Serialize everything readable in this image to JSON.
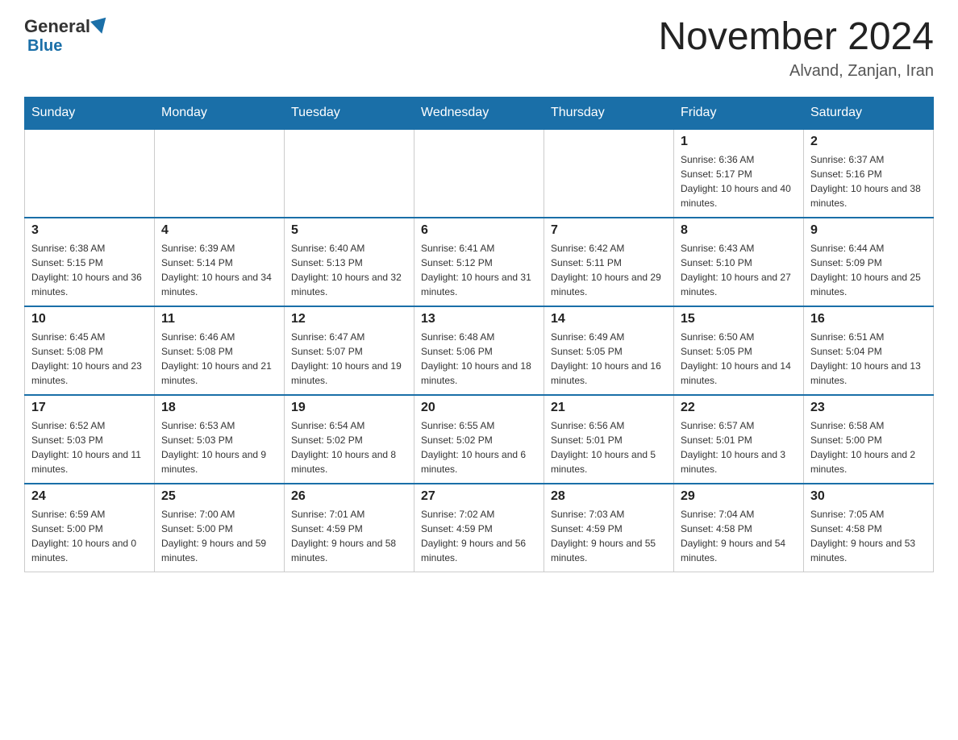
{
  "header": {
    "logo_general": "General",
    "logo_blue": "Blue",
    "month_title": "November 2024",
    "location": "Alvand, Zanjan, Iran"
  },
  "weekdays": [
    "Sunday",
    "Monday",
    "Tuesday",
    "Wednesday",
    "Thursday",
    "Friday",
    "Saturday"
  ],
  "weeks": [
    [
      {
        "day": "",
        "sunrise": "",
        "sunset": "",
        "daylight": ""
      },
      {
        "day": "",
        "sunrise": "",
        "sunset": "",
        "daylight": ""
      },
      {
        "day": "",
        "sunrise": "",
        "sunset": "",
        "daylight": ""
      },
      {
        "day": "",
        "sunrise": "",
        "sunset": "",
        "daylight": ""
      },
      {
        "day": "",
        "sunrise": "",
        "sunset": "",
        "daylight": ""
      },
      {
        "day": "1",
        "sunrise": "Sunrise: 6:36 AM",
        "sunset": "Sunset: 5:17 PM",
        "daylight": "Daylight: 10 hours and 40 minutes."
      },
      {
        "day": "2",
        "sunrise": "Sunrise: 6:37 AM",
        "sunset": "Sunset: 5:16 PM",
        "daylight": "Daylight: 10 hours and 38 minutes."
      }
    ],
    [
      {
        "day": "3",
        "sunrise": "Sunrise: 6:38 AM",
        "sunset": "Sunset: 5:15 PM",
        "daylight": "Daylight: 10 hours and 36 minutes."
      },
      {
        "day": "4",
        "sunrise": "Sunrise: 6:39 AM",
        "sunset": "Sunset: 5:14 PM",
        "daylight": "Daylight: 10 hours and 34 minutes."
      },
      {
        "day": "5",
        "sunrise": "Sunrise: 6:40 AM",
        "sunset": "Sunset: 5:13 PM",
        "daylight": "Daylight: 10 hours and 32 minutes."
      },
      {
        "day": "6",
        "sunrise": "Sunrise: 6:41 AM",
        "sunset": "Sunset: 5:12 PM",
        "daylight": "Daylight: 10 hours and 31 minutes."
      },
      {
        "day": "7",
        "sunrise": "Sunrise: 6:42 AM",
        "sunset": "Sunset: 5:11 PM",
        "daylight": "Daylight: 10 hours and 29 minutes."
      },
      {
        "day": "8",
        "sunrise": "Sunrise: 6:43 AM",
        "sunset": "Sunset: 5:10 PM",
        "daylight": "Daylight: 10 hours and 27 minutes."
      },
      {
        "day": "9",
        "sunrise": "Sunrise: 6:44 AM",
        "sunset": "Sunset: 5:09 PM",
        "daylight": "Daylight: 10 hours and 25 minutes."
      }
    ],
    [
      {
        "day": "10",
        "sunrise": "Sunrise: 6:45 AM",
        "sunset": "Sunset: 5:08 PM",
        "daylight": "Daylight: 10 hours and 23 minutes."
      },
      {
        "day": "11",
        "sunrise": "Sunrise: 6:46 AM",
        "sunset": "Sunset: 5:08 PM",
        "daylight": "Daylight: 10 hours and 21 minutes."
      },
      {
        "day": "12",
        "sunrise": "Sunrise: 6:47 AM",
        "sunset": "Sunset: 5:07 PM",
        "daylight": "Daylight: 10 hours and 19 minutes."
      },
      {
        "day": "13",
        "sunrise": "Sunrise: 6:48 AM",
        "sunset": "Sunset: 5:06 PM",
        "daylight": "Daylight: 10 hours and 18 minutes."
      },
      {
        "day": "14",
        "sunrise": "Sunrise: 6:49 AM",
        "sunset": "Sunset: 5:05 PM",
        "daylight": "Daylight: 10 hours and 16 minutes."
      },
      {
        "day": "15",
        "sunrise": "Sunrise: 6:50 AM",
        "sunset": "Sunset: 5:05 PM",
        "daylight": "Daylight: 10 hours and 14 minutes."
      },
      {
        "day": "16",
        "sunrise": "Sunrise: 6:51 AM",
        "sunset": "Sunset: 5:04 PM",
        "daylight": "Daylight: 10 hours and 13 minutes."
      }
    ],
    [
      {
        "day": "17",
        "sunrise": "Sunrise: 6:52 AM",
        "sunset": "Sunset: 5:03 PM",
        "daylight": "Daylight: 10 hours and 11 minutes."
      },
      {
        "day": "18",
        "sunrise": "Sunrise: 6:53 AM",
        "sunset": "Sunset: 5:03 PM",
        "daylight": "Daylight: 10 hours and 9 minutes."
      },
      {
        "day": "19",
        "sunrise": "Sunrise: 6:54 AM",
        "sunset": "Sunset: 5:02 PM",
        "daylight": "Daylight: 10 hours and 8 minutes."
      },
      {
        "day": "20",
        "sunrise": "Sunrise: 6:55 AM",
        "sunset": "Sunset: 5:02 PM",
        "daylight": "Daylight: 10 hours and 6 minutes."
      },
      {
        "day": "21",
        "sunrise": "Sunrise: 6:56 AM",
        "sunset": "Sunset: 5:01 PM",
        "daylight": "Daylight: 10 hours and 5 minutes."
      },
      {
        "day": "22",
        "sunrise": "Sunrise: 6:57 AM",
        "sunset": "Sunset: 5:01 PM",
        "daylight": "Daylight: 10 hours and 3 minutes."
      },
      {
        "day": "23",
        "sunrise": "Sunrise: 6:58 AM",
        "sunset": "Sunset: 5:00 PM",
        "daylight": "Daylight: 10 hours and 2 minutes."
      }
    ],
    [
      {
        "day": "24",
        "sunrise": "Sunrise: 6:59 AM",
        "sunset": "Sunset: 5:00 PM",
        "daylight": "Daylight: 10 hours and 0 minutes."
      },
      {
        "day": "25",
        "sunrise": "Sunrise: 7:00 AM",
        "sunset": "Sunset: 5:00 PM",
        "daylight": "Daylight: 9 hours and 59 minutes."
      },
      {
        "day": "26",
        "sunrise": "Sunrise: 7:01 AM",
        "sunset": "Sunset: 4:59 PM",
        "daylight": "Daylight: 9 hours and 58 minutes."
      },
      {
        "day": "27",
        "sunrise": "Sunrise: 7:02 AM",
        "sunset": "Sunset: 4:59 PM",
        "daylight": "Daylight: 9 hours and 56 minutes."
      },
      {
        "day": "28",
        "sunrise": "Sunrise: 7:03 AM",
        "sunset": "Sunset: 4:59 PM",
        "daylight": "Daylight: 9 hours and 55 minutes."
      },
      {
        "day": "29",
        "sunrise": "Sunrise: 7:04 AM",
        "sunset": "Sunset: 4:58 PM",
        "daylight": "Daylight: 9 hours and 54 minutes."
      },
      {
        "day": "30",
        "sunrise": "Sunrise: 7:05 AM",
        "sunset": "Sunset: 4:58 PM",
        "daylight": "Daylight: 9 hours and 53 minutes."
      }
    ]
  ]
}
